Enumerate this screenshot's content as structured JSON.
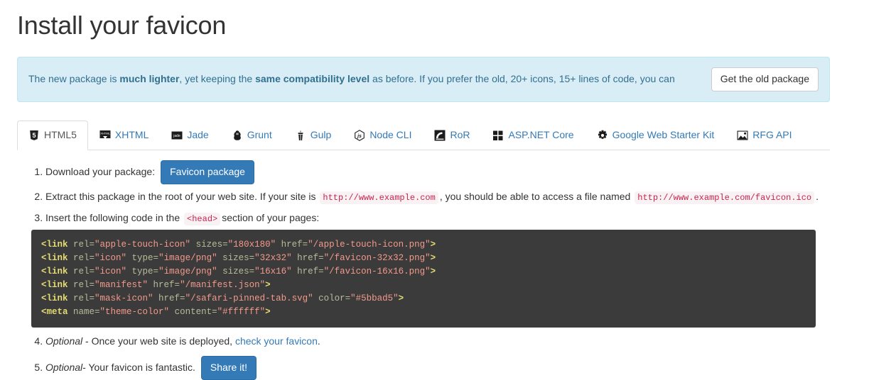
{
  "page": {
    "title": "Install your favicon"
  },
  "alert": {
    "text_1": "The new package is ",
    "bold_1": "much lighter",
    "text_2": ", yet keeping the ",
    "bold_2": "same compatibility level",
    "text_3": " as before. If you prefer the old, 20+ icons, 15+ lines of code, you can",
    "button_label": "Get the old package",
    "bg_color": "#d9edf7",
    "border_color": "#bce8f1",
    "text_color": "#31708f"
  },
  "tabs": [
    {
      "label": "HTML5",
      "icon": "html5-icon",
      "active": true
    },
    {
      "label": "XHTML",
      "icon": "xhtml-icon",
      "active": false
    },
    {
      "label": "Jade",
      "icon": "jade-icon",
      "active": false
    },
    {
      "label": "Grunt",
      "icon": "grunt-icon",
      "active": false
    },
    {
      "label": "Gulp",
      "icon": "gulp-icon",
      "active": false
    },
    {
      "label": "Node CLI",
      "icon": "node-cli-icon",
      "active": false
    },
    {
      "label": "RoR",
      "icon": "ror-icon",
      "active": false
    },
    {
      "label": "ASP.NET Core",
      "icon": "aspnet-core-icon",
      "active": false
    },
    {
      "label": "Google Web Starter Kit",
      "icon": "google-wsk-icon",
      "active": false
    },
    {
      "label": "RFG API",
      "icon": "rfg-api-icon",
      "active": false
    }
  ],
  "steps": {
    "step1": {
      "text": "Download your package:",
      "button_label": "Favicon package"
    },
    "step2": {
      "text_1": "Extract this package in the root of your web site. If your site is",
      "code_1": "http://www.example.com",
      "text_2": ", you should be able to access a file named",
      "code_2": "http://www.example.com/favicon.ico",
      "text_3": "."
    },
    "step3": {
      "text_1": "Insert the following code in the",
      "code_1": "<head>",
      "text_2": "section of your pages:"
    },
    "step4": {
      "optional": "Optional",
      "text_1": " - Once your web site is deployed,",
      "link": "check your favicon",
      "text_2": "."
    },
    "step5": {
      "optional": "Optional",
      "text_1": " - Your favicon is fantastic.",
      "button_label": "Share it!"
    }
  },
  "code": {
    "lines": [
      [
        {
          "t": "tag",
          "v": "<link"
        },
        {
          "t": "attr",
          "v": " rel="
        },
        {
          "t": "val",
          "v": "\"apple-touch-icon\""
        },
        {
          "t": "attr",
          "v": " sizes="
        },
        {
          "t": "val",
          "v": "\"180x180\""
        },
        {
          "t": "attr",
          "v": " href="
        },
        {
          "t": "val",
          "v": "\"/apple-touch-icon.png\""
        },
        {
          "t": "gt",
          "v": ">"
        }
      ],
      [
        {
          "t": "tag",
          "v": "<link"
        },
        {
          "t": "attr",
          "v": " rel="
        },
        {
          "t": "val",
          "v": "\"icon\""
        },
        {
          "t": "attr",
          "v": " type="
        },
        {
          "t": "val",
          "v": "\"image/png\""
        },
        {
          "t": "attr",
          "v": " sizes="
        },
        {
          "t": "val",
          "v": "\"32x32\""
        },
        {
          "t": "attr",
          "v": " href="
        },
        {
          "t": "val",
          "v": "\"/favicon-32x32.png\""
        },
        {
          "t": "gt",
          "v": ">"
        }
      ],
      [
        {
          "t": "tag",
          "v": "<link"
        },
        {
          "t": "attr",
          "v": " rel="
        },
        {
          "t": "val",
          "v": "\"icon\""
        },
        {
          "t": "attr",
          "v": " type="
        },
        {
          "t": "val",
          "v": "\"image/png\""
        },
        {
          "t": "attr",
          "v": " sizes="
        },
        {
          "t": "val",
          "v": "\"16x16\""
        },
        {
          "t": "attr",
          "v": " href="
        },
        {
          "t": "val",
          "v": "\"/favicon-16x16.png\""
        },
        {
          "t": "gt",
          "v": ">"
        }
      ],
      [
        {
          "t": "tag",
          "v": "<link"
        },
        {
          "t": "attr",
          "v": " rel="
        },
        {
          "t": "val",
          "v": "\"manifest\""
        },
        {
          "t": "attr",
          "v": " href="
        },
        {
          "t": "val",
          "v": "\"/manifest.json\""
        },
        {
          "t": "gt",
          "v": ">"
        }
      ],
      [
        {
          "t": "tag",
          "v": "<link"
        },
        {
          "t": "attr",
          "v": " rel="
        },
        {
          "t": "val",
          "v": "\"mask-icon\""
        },
        {
          "t": "attr",
          "v": " href="
        },
        {
          "t": "val",
          "v": "\"/safari-pinned-tab.svg\""
        },
        {
          "t": "attr",
          "v": " color="
        },
        {
          "t": "val",
          "v": "\"#5bbad5\""
        },
        {
          "t": "gt",
          "v": ">"
        }
      ],
      [
        {
          "t": "tag",
          "v": "<meta"
        },
        {
          "t": "attr",
          "v": " name="
        },
        {
          "t": "val",
          "v": "\"theme-color\""
        },
        {
          "t": "attr",
          "v": " content="
        },
        {
          "t": "val",
          "v": "\"#ffffff\""
        },
        {
          "t": "gt",
          "v": ">"
        }
      ]
    ],
    "bg_color": "#3b3b3b",
    "tag_color": "#e6db74",
    "attr_color": "#b8bb9a",
    "value_color": "#f49a8c"
  }
}
